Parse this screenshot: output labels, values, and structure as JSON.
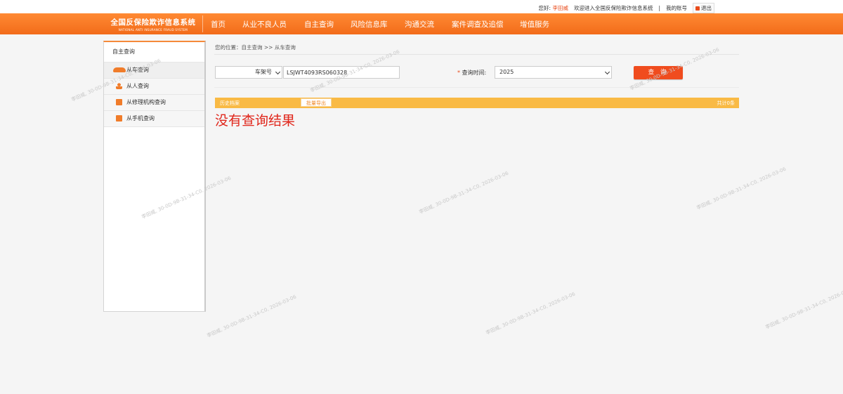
{
  "topbar": {
    "greeting": "您好:",
    "username": "李田威",
    "welcome": "欢迎进入全国反保险欺诈信息系统",
    "separator": "|",
    "my_account": "我的账号",
    "logout": "退出"
  },
  "logo": {
    "title": "全国反保险欺诈信息系统",
    "subtitle": "NATIONAL ANTI INSURANCE FRAUD SYSTEM"
  },
  "nav": [
    "首页",
    "从业不良人员",
    "自主查询",
    "风险信息库",
    "沟通交流",
    "案件调查及追偿",
    "增值服务"
  ],
  "sidebar": {
    "title": "自主查询",
    "items": [
      {
        "label": "从车查询",
        "icon": "car-icon"
      },
      {
        "label": "从人查询",
        "icon": "person-icon"
      },
      {
        "label": "从修理机构查询",
        "icon": "document-icon"
      },
      {
        "label": "从手机查询",
        "icon": "document-icon"
      }
    ]
  },
  "breadcrumb": "您的位置：自主查询 >> 从车查询",
  "form": {
    "query_type": "车架号",
    "vin_value": "LSJWT4093RS060328",
    "time_label": "查询时间:",
    "time_star": "*",
    "year": "2025",
    "query_button": "查 询"
  },
  "results": {
    "history_label": "历史档案",
    "export_button": "批量导出",
    "total": "共计0条",
    "empty_message": "没有查询结果"
  },
  "watermark": "李田威, 30-0D-9B-31-34-C0, 2026-03-06",
  "colors": {
    "nav_orange": "#f26b1a",
    "result_bar": "#f9ba45",
    "button_red": "#f04c1e",
    "empty_text": "#e0261b"
  }
}
